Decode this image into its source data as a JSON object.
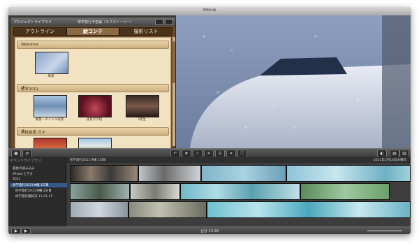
{
  "window": {
    "title": "iMovie"
  },
  "project_bar": {
    "label": "プロジェクトライブラリ",
    "title": "修学旅行予告編（ラフストーリー）"
  },
  "tabs": [
    {
      "label": "アウトライン"
    },
    {
      "label": "絵コンテ"
    },
    {
      "label": "撮影リスト"
    }
  ],
  "storyboard": {
    "sections": [
      {
        "title": "Welcome",
        "clips": [
          {
            "caption": "風景"
          }
        ]
      },
      {
        "title": "修学2011",
        "clips": [
          {
            "caption": "風景・タイトル背景"
          },
          {
            "caption": "夜景学学院"
          },
          {
            "caption": "3年生"
          }
        ]
      },
      {
        "title": "学校前景 ガマ",
        "clips": []
      }
    ]
  },
  "library": {
    "title": "イベントライブラリ",
    "items": [
      {
        "label": "最後の読み込み"
      },
      {
        "label": "iPhoto ビデオ"
      },
      {
        "label": "2011"
      },
      {
        "label": "修学旅行2011沖縄 1日目"
      },
      {
        "label": "修学旅行2011沖縄 2日目"
      },
      {
        "label": "修学旅行最終日 11-01-15"
      }
    ]
  },
  "event_header": {
    "title": "修学旅行2011沖縄 1日目",
    "date": "2011年5月16日木曜日"
  },
  "status": {
    "text": "合計 23:38"
  },
  "colors": {
    "accent": "#355a8a",
    "wood": "#6a4b2d",
    "parchment": "#f1e2c2"
  }
}
